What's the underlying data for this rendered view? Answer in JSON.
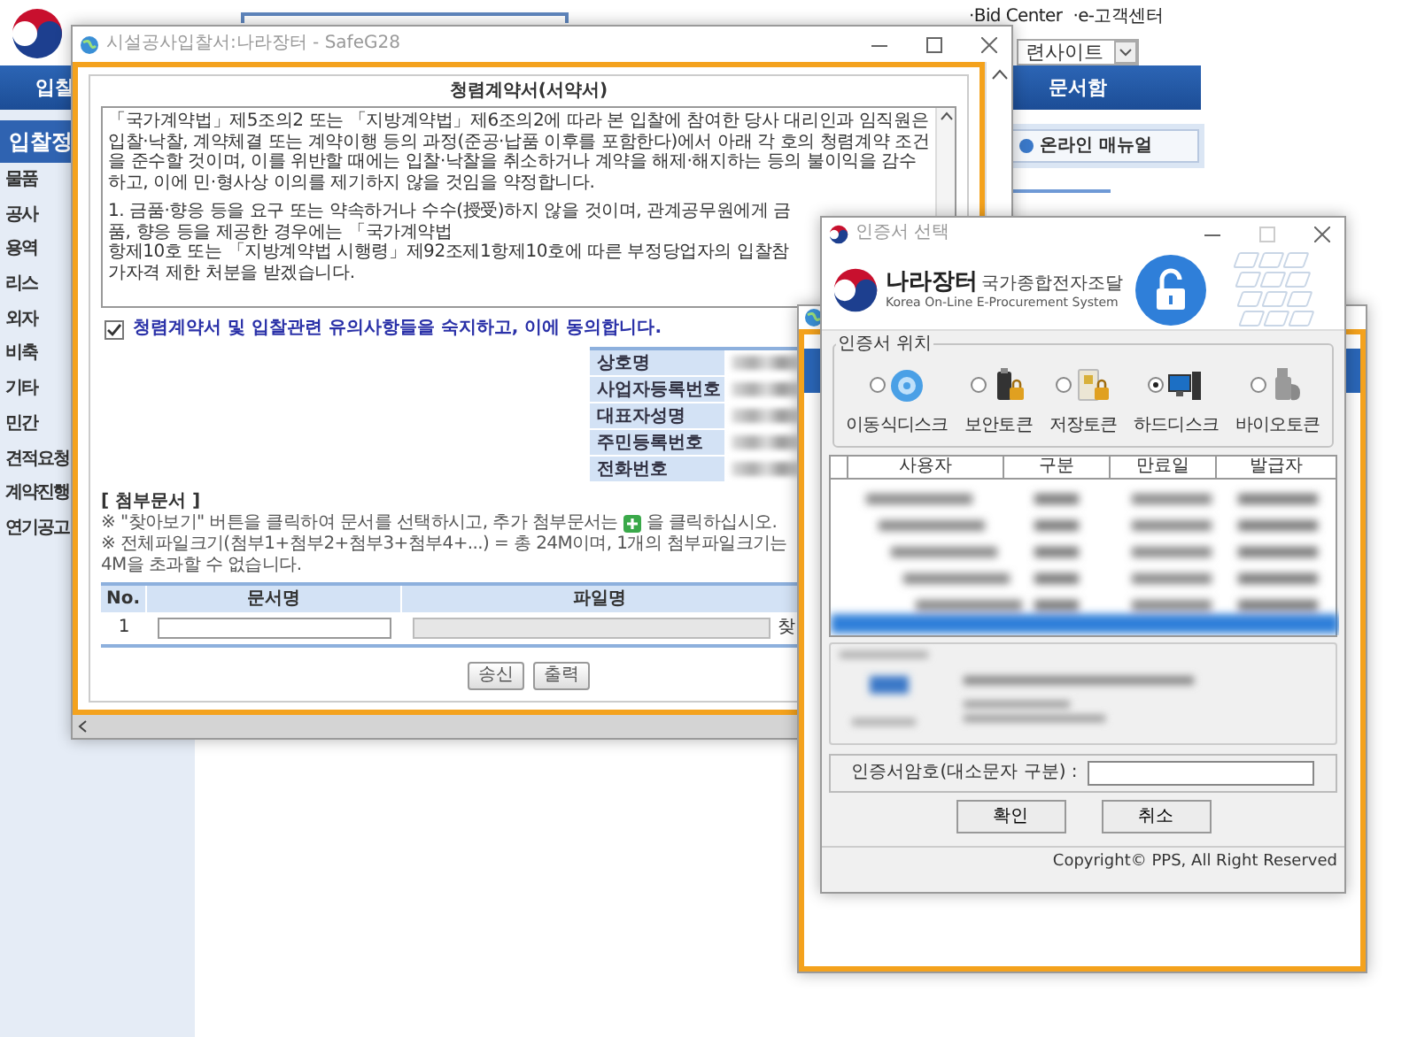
{
  "background_page": {
    "top_links": [
      "·Bid Center",
      "·e-고객센터"
    ],
    "site_select": {
      "value": "련사이트"
    },
    "nav": [
      "입찰",
      "문서함"
    ],
    "sidebar": {
      "title": "입찰정",
      "items": [
        "물품",
        "공사",
        "용역",
        "리스",
        "외자",
        "비축",
        "기타",
        "민간",
        "견적요청",
        "계약진행",
        "연기공고"
      ]
    },
    "manual_button": "온라인 매뉴얼"
  },
  "bid_window": {
    "title": "시설공사입찰서:나라장터 - SafeG28",
    "heading": "청렴계약서(서약서)",
    "agreement_paragraphs": [
      "「국가계약법」제5조의2 또는 「지방계약법」제6조의2에 따라 본 입찰에 참여한 당사 대리인과 임직원은 입찰·낙찰, 계약체결 또는 계약이행 등의 과정(준공·납품 이후를 포함한다)에서 아래 각 호의 청렴계약 조건을 준수할 것이며, 이를 위반할 때에는 입찰·낙찰을 취소하거나 계약을 해제·해지하는 등의 불이익을 감수하고, 이에 민·형사상 이의를 제기하지 않을 것임을 약정합니다.",
      "1. 금품·향응 등을 요구 또는 약속하거나 수수(授受)하지 않을 것이며, 관계공무원에게 금품, 향응 등을 제공한 경우에는 「국가계약법",
      "항제10호 또는 「지방계약법 시행령」제92조제1항제10호에 따른 부정당업자의 입찰참가자격 제한 처분을 받겠습니다."
    ],
    "agree_checkbox": {
      "label": "청렴계약서 및 입찰관련 유의사항들을 숙지하고, 이에 동의합니다.",
      "checked": true
    },
    "company_fields": [
      "상호명",
      "사업자등록번호",
      "대표자성명",
      "주민등록번호",
      "전화번호"
    ],
    "attachments": {
      "title": "[ 첨부문서 ]",
      "note_1": {
        "before": "※ \"찾아보기\" 버튼을 클릭하여 문서를 선택하시고, 추가 첨부문서는",
        "after": "을 클릭하십시오."
      },
      "note_2": "※ 전체파일크기(첨부1+첨부2+첨부3+첨부4+...) = 총 24M이며, 1개의 첨부파일크기는 4M을 초과할 수 없습니다.",
      "columns": [
        "No.",
        "문서명",
        "파일명"
      ],
      "rows": [
        {
          "no": "1",
          "browse": "찾"
        }
      ]
    },
    "buttons": [
      "송신",
      "출력"
    ]
  },
  "cert_dialog": {
    "title": "인증서 선택",
    "brand": {
      "name": "나라장터",
      "subtitle": "국가종합전자조달",
      "tagline": "Korea On-Line E-Procurement System"
    },
    "location_group": {
      "title": "인증서 위치",
      "options": [
        {
          "label": "이동식디스크",
          "kind": "disk",
          "selected": false
        },
        {
          "label": "보안토큰",
          "kind": "usb_token",
          "selected": false
        },
        {
          "label": "저장토큰",
          "kind": "card_token",
          "selected": false
        },
        {
          "label": "하드디스크",
          "kind": "computer",
          "selected": true
        },
        {
          "label": "바이오토큰",
          "kind": "bio_token",
          "selected": false
        }
      ]
    },
    "columns": [
      "사용자",
      "구분",
      "만료일",
      "발급자"
    ],
    "password": {
      "label": "인증서암호(대소문자 구분) :"
    },
    "buttons": [
      "확인",
      "취소"
    ],
    "copyright": "Copyright© PPS, All Right Reserved"
  }
}
